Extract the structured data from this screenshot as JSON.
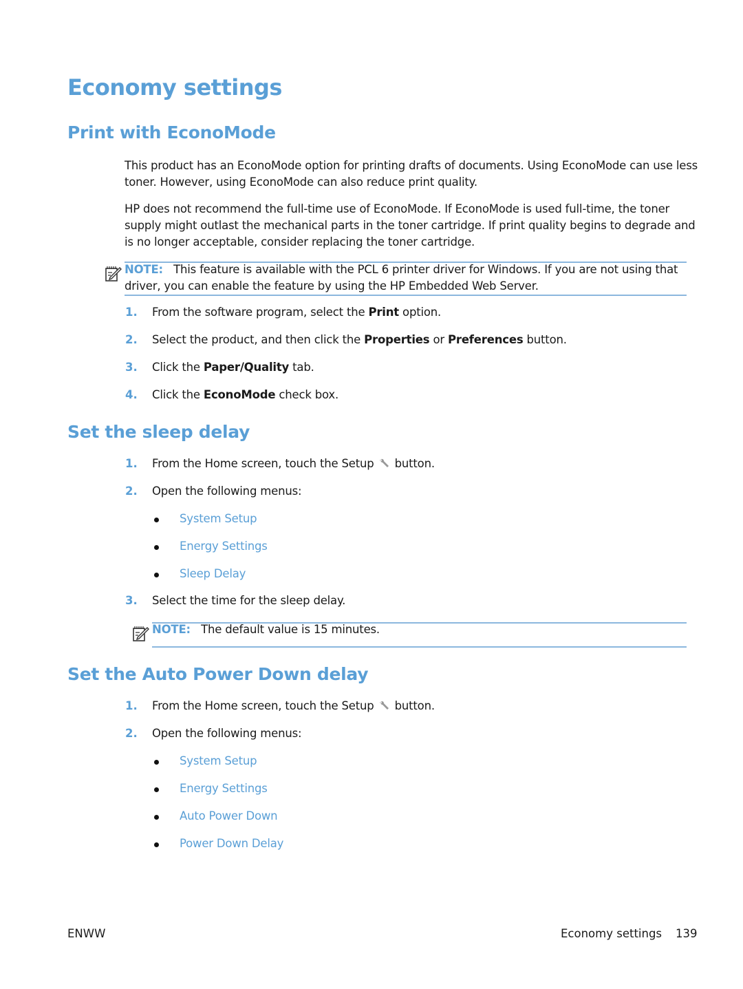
{
  "title": "Economy settings",
  "sections": {
    "econo": {
      "heading": "Print with EconoMode",
      "para1_line1": "This product has an EconoMode option for printing drafts of documents. Using EconoMode can use less",
      "para1_line2": "toner. However, using EconoMode can also reduce print quality.",
      "para2_line1": "HP does not recommend the full-time use of EconoMode. If EconoMode is used full-time, the toner",
      "para2_line2": "supply might outlast the mechanical parts in the toner cartridge. If print quality begins to degrade and",
      "para2_line3": "is no longer acceptable, consider replacing the toner cartridge.",
      "note": {
        "label": "NOTE:",
        "line1": "This feature is available with the PCL 6 printer driver for Windows. If you are not using that",
        "line2": "driver, you can enable the feature by using the HP Embedded Web Server."
      },
      "steps": [
        {
          "num": "1.",
          "pre": "From the software program, select the ",
          "b1": "Print",
          "post": " option."
        },
        {
          "num": "2.",
          "pre": "Select the product, and then click the ",
          "b1": "Properties",
          "mid": " or ",
          "b2": "Preferences",
          "post": " button."
        },
        {
          "num": "3.",
          "pre": "Click the ",
          "b1": "Paper/Quality",
          "post": " tab."
        },
        {
          "num": "4.",
          "pre": "Click the ",
          "b1": "EconoMode",
          "post": " check box."
        }
      ]
    },
    "sleep": {
      "heading": "Set the sleep delay",
      "steps": [
        {
          "num": "1.",
          "pre": "From the Home screen, touch the Setup",
          "post": "button.",
          "icon": "wrench-icon"
        },
        {
          "num": "2.",
          "text": "Open the following menus:"
        },
        {
          "num": "3.",
          "text": "Select the time for the sleep delay."
        }
      ],
      "menus": [
        "System Setup",
        "Energy Settings",
        "Sleep Delay"
      ],
      "note": {
        "label": "NOTE:",
        "text": "The default value is 15 minutes."
      }
    },
    "apd": {
      "heading": "Set the Auto Power Down delay",
      "steps": [
        {
          "num": "1.",
          "pre": "From the Home screen, touch the Setup",
          "post": "button.",
          "icon": "wrench-icon"
        },
        {
          "num": "2.",
          "text": "Open the following menus:"
        }
      ],
      "menus": [
        "System Setup",
        "Energy Settings",
        "Auto Power Down",
        "Power Down Delay"
      ]
    }
  },
  "footer": {
    "left": "ENWW",
    "section": "Economy settings",
    "page": "139"
  },
  "colors": {
    "accent": "#5a9fd6",
    "note_rule": "#8bb7de",
    "text": "#1a1a1a"
  }
}
